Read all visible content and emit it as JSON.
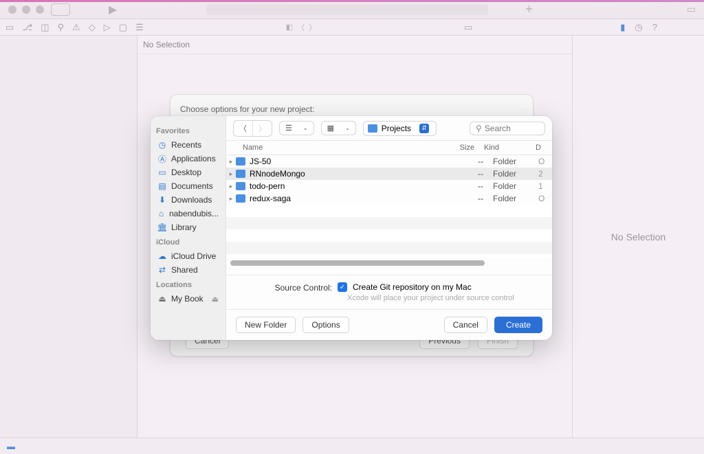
{
  "titlebar": {
    "play": "▶",
    "plus": "+",
    "lib": "▭"
  },
  "toolbar2": {
    "nav_panel": "◧",
    "nav_back": "〈",
    "nav_fwd": "〉"
  },
  "nosel": "No Selection",
  "rightpanel": {
    "nosel": "No Selection"
  },
  "wizard": {
    "title": "Choose options for your new project:",
    "cancel": "Cancel",
    "previous": "Previous",
    "finish": "Finish"
  },
  "dialog": {
    "sidebar": {
      "favorites_label": "Favorites",
      "favorites": [
        {
          "icon": "clock",
          "label": "Recents"
        },
        {
          "icon": "app",
          "label": "Applications"
        },
        {
          "icon": "desktop",
          "label": "Desktop"
        },
        {
          "icon": "doc",
          "label": "Documents"
        },
        {
          "icon": "down",
          "label": "Downloads"
        },
        {
          "icon": "home",
          "label": "nabendubis..."
        },
        {
          "icon": "lib",
          "label": "Library"
        }
      ],
      "icloud_label": "iCloud",
      "icloud": [
        {
          "icon": "cloud",
          "label": "iCloud Drive"
        },
        {
          "icon": "shared",
          "label": "Shared"
        }
      ],
      "locations_label": "Locations",
      "locations": [
        {
          "icon": "disk",
          "label": "My Book",
          "eject": true
        }
      ]
    },
    "path_label": "Projects",
    "search_placeholder": "Search",
    "columns": {
      "name": "Name",
      "size": "Size",
      "kind": "Kind",
      "d": "D"
    },
    "rows": [
      {
        "name": "JS-50",
        "size": "--",
        "kind": "Folder",
        "d": "O",
        "sel": false
      },
      {
        "name": "RNnodeMongo",
        "size": "--",
        "kind": "Folder",
        "d": "2",
        "sel": true
      },
      {
        "name": "todo-pern",
        "size": "--",
        "kind": "Folder",
        "d": "1",
        "sel": false
      },
      {
        "name": "redux-saga",
        "size": "--",
        "kind": "Folder",
        "d": "O",
        "sel": false
      }
    ],
    "source_control_label": "Source Control:",
    "git_checkbox_label": "Create Git repository on my Mac",
    "git_help": "Xcode will place your project under source control",
    "new_folder": "New Folder",
    "options": "Options",
    "cancel": "Cancel",
    "create": "Create"
  }
}
